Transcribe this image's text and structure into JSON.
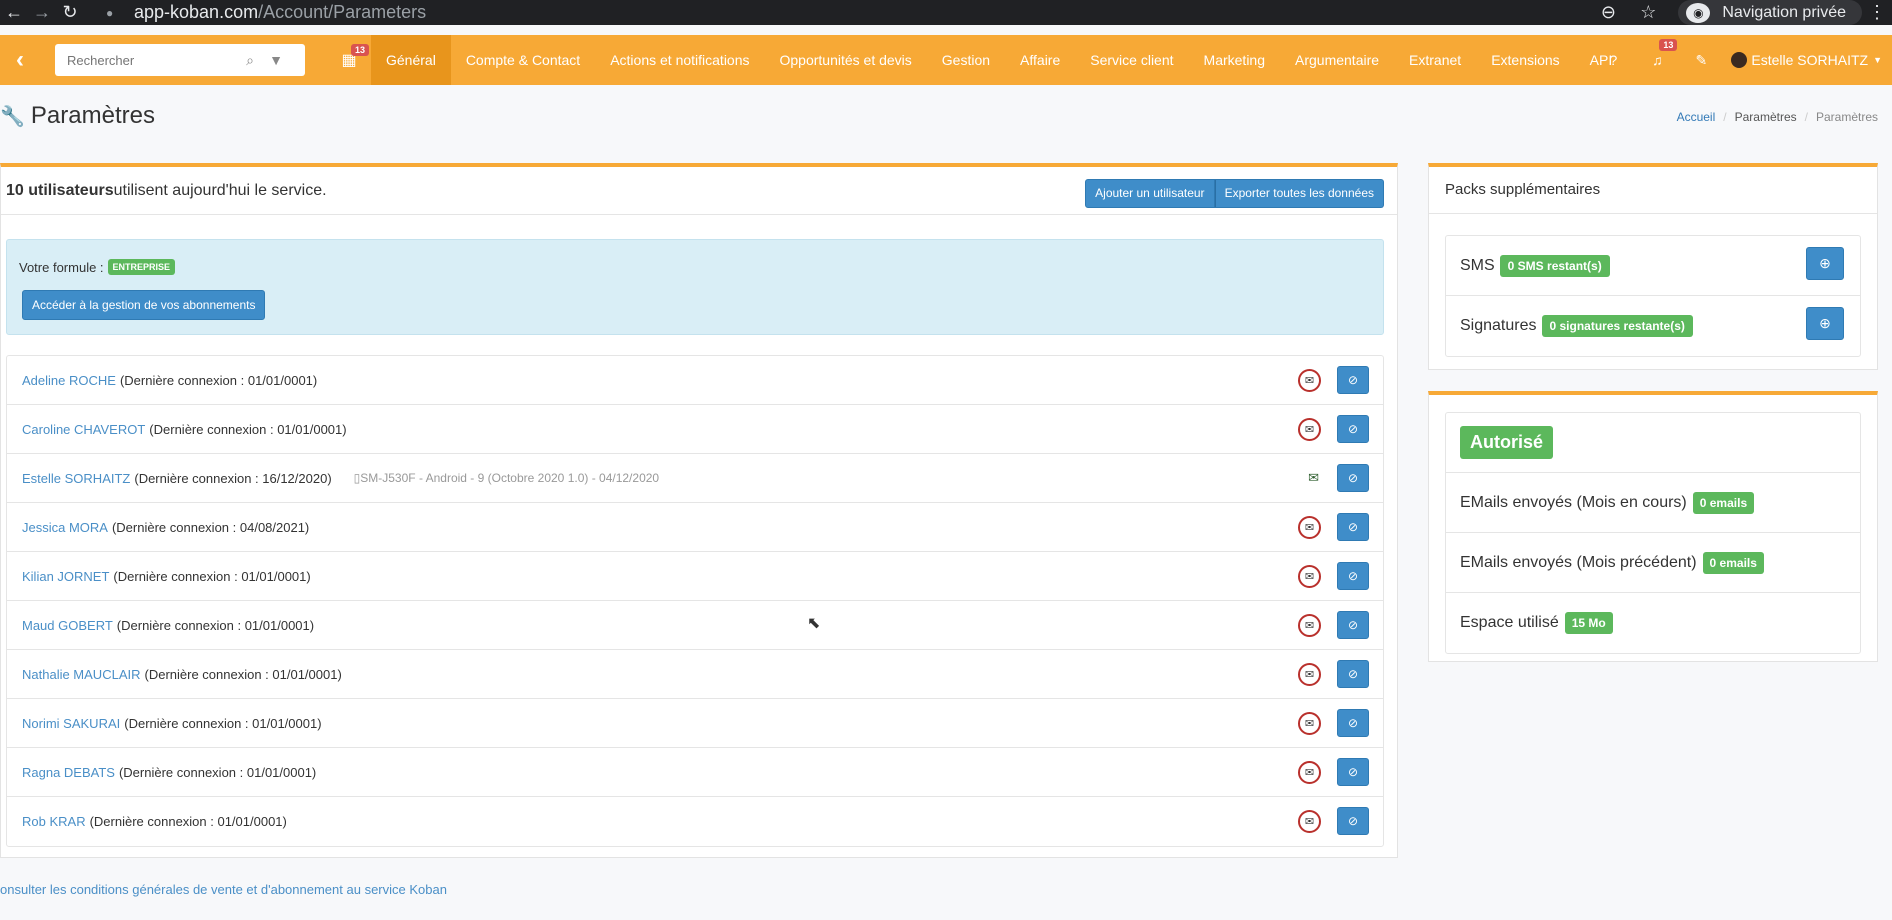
{
  "browser": {
    "url_host": "app-koban.com",
    "url_path": "/Account/Parameters",
    "incognito_label": "Navigation privée"
  },
  "navbar": {
    "search_placeholder": "Rechercher",
    "calendar_badge": "13",
    "menu": [
      {
        "label": "Général",
        "active": true
      },
      {
        "label": "Compte & Contact"
      },
      {
        "label": "Actions et notifications"
      },
      {
        "label": "Opportunités et devis"
      },
      {
        "label": "Gestion"
      },
      {
        "label": "Affaire"
      },
      {
        "label": "Service client"
      },
      {
        "label": "Marketing"
      },
      {
        "label": "Argumentaire"
      },
      {
        "label": "Extranet"
      },
      {
        "label": "Extensions"
      },
      {
        "label": "API"
      }
    ],
    "notif_badge": "13",
    "user_name": "Estelle SORHAITZ"
  },
  "page": {
    "title": "Paramètres",
    "breadcrumb": [
      "Accueil",
      "Paramètres",
      "Paramètres"
    ]
  },
  "main": {
    "users_count": "10 utilisateurs",
    "users_text": " utilisent aujourd'hui le service.",
    "add_user_button": "Ajouter un utilisateur",
    "export_button": "Exporter toutes les données",
    "formule_label": "Votre formule :",
    "formule_badge": "ENTREPRISE",
    "manage_subscriptions_button": "Accéder à la gestion de vos abonnements",
    "users": [
      {
        "name": "Adeline ROCHE",
        "connection": "(Dernière connexion : 01/01/0001)",
        "device": "",
        "mail": false
      },
      {
        "name": "Caroline CHAVEROT",
        "connection": "(Dernière connexion : 01/01/0001)",
        "device": "",
        "mail": false
      },
      {
        "name": "Estelle SORHAITZ",
        "connection": "(Dernière connexion : 16/12/2020)",
        "device": "▯SM-J530F - Android - 9 (Octobre 2020 1.0) - 04/12/2020",
        "mail": true
      },
      {
        "name": "Jessica MORA",
        "connection": "(Dernière connexion : 04/08/2021)",
        "device": "",
        "mail": false
      },
      {
        "name": "Kilian JORNET",
        "connection": "(Dernière connexion : 01/01/0001)",
        "device": "",
        "mail": false
      },
      {
        "name": "Maud GOBERT",
        "connection": "(Dernière connexion : 01/01/0001)",
        "device": "",
        "mail": false
      },
      {
        "name": "Nathalie MAUCLAIR",
        "connection": "(Dernière connexion : 01/01/0001)",
        "device": "",
        "mail": false
      },
      {
        "name": "Norimi SAKURAI",
        "connection": "(Dernière connexion : 01/01/0001)",
        "device": "",
        "mail": false
      },
      {
        "name": "Ragna DEBATS",
        "connection": "(Dernière connexion : 01/01/0001)",
        "device": "",
        "mail": false
      },
      {
        "name": "Rob KRAR",
        "connection": "(Dernière connexion : 01/01/0001)",
        "device": "",
        "mail": false
      }
    ],
    "cgv_link": "onsulter les conditions générales de vente et d'abonnement au service Koban"
  },
  "packs": {
    "title": "Packs supplémentaires",
    "items": [
      {
        "label": "SMS",
        "badge": "0 SMS restant(s)"
      },
      {
        "label": "Signatures",
        "badge": "0 signatures restante(s)"
      }
    ]
  },
  "email_status": {
    "status_badge": "Autorisé",
    "rows": [
      {
        "label": "EMails envoyés (Mois en cours)",
        "badge": "0 emails"
      },
      {
        "label": "EMails envoyés (Mois précédent)",
        "badge": "0 emails"
      },
      {
        "label": "Espace utilisé",
        "badge": "15 Mo"
      }
    ]
  },
  "colors": {
    "navbar": "#f7a936",
    "active_menu": "#e8951c",
    "primary_button": "#3f8dc9",
    "success_badge": "#5cb85c",
    "danger": "#d9534f"
  }
}
